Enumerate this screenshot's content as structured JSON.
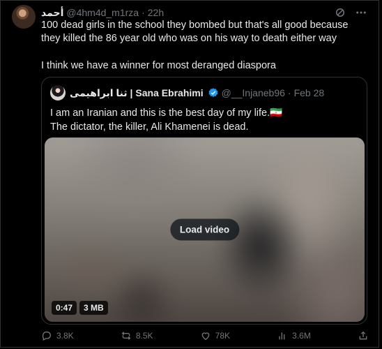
{
  "tweet": {
    "display_name": "أحمد",
    "handle": "@4hm4d_m1rza",
    "separator": "·",
    "time": "22h",
    "body_paragraphs": [
      "100 dead girls in the school they bombed but that's all good because they killed the 86 year old who was on his way to death either way",
      "I think we have a winner for most deranged diaspora"
    ]
  },
  "quoted": {
    "display_name": "ثنا ابراهیمی | Sana Ebrahimi",
    "handle": "@__Injaneb96",
    "separator": "·",
    "time": "Feb 28",
    "line1": "I am an Iranian and this is the best day of my life.",
    "flag": "🇮🇷",
    "line2": "The dictator, the killer, Ali Khamenei is dead.",
    "video": {
      "load_label": "Load video",
      "duration": "0:47",
      "size": "3 MB"
    }
  },
  "actions": {
    "replies": "3.8K",
    "reposts": "8.5K",
    "likes": "78K",
    "views": "3.6M"
  },
  "icons": {
    "header": [
      "grok-icon",
      "more-icon"
    ],
    "actions": [
      "reply-icon",
      "repost-icon",
      "like-icon",
      "views-icon",
      "share-icon"
    ]
  }
}
